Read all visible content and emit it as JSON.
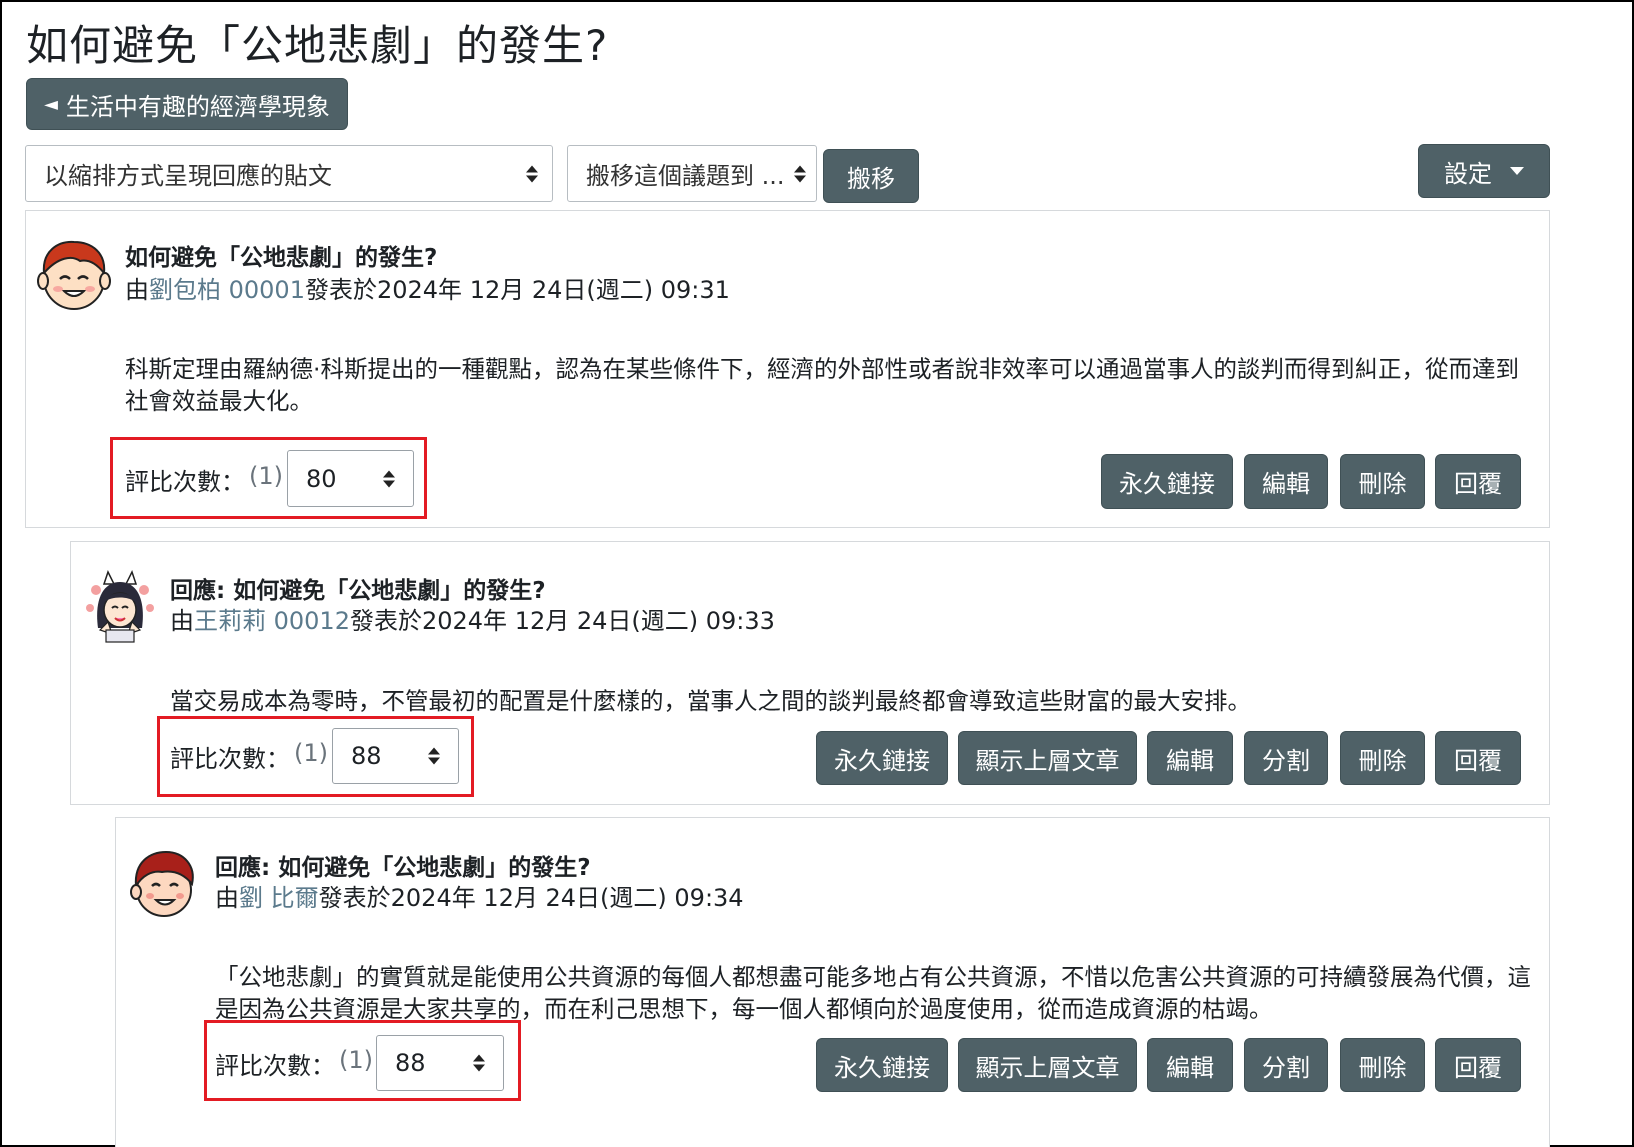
{
  "page": {
    "title": "如何避免「公地悲劇」的發生?"
  },
  "toolbar": {
    "back_button": "生活中有趣的經濟學現象",
    "display_mode_select": "以縮排方式呈現回應的貼文",
    "move_select": "搬移這個議題到 ...",
    "move_button": "搬移",
    "settings_button": "設定"
  },
  "posts": [
    {
      "title": "如何避免「公地悲劇」的發生?",
      "meta_prefix": "由",
      "author": "劉包柏 00001",
      "meta_suffix": "發表於2024年 12月 24日(週二) 09:31",
      "body": "科斯定理由羅納德·科斯提出的一種觀點，認為在某些條件下，經濟的外部性或者說非效率可以通過當事人的談判而得到糾正，從而達到社會效益最大化。",
      "rating_label": "評比次數：",
      "rating_count": "(1)",
      "rating_value": "80",
      "actions": [
        "永久鏈接",
        "編輯",
        "刪除",
        "回覆"
      ]
    },
    {
      "title": "回應: 如何避免「公地悲劇」的發生?",
      "meta_prefix": "由",
      "author": "王莉莉 00012",
      "meta_suffix": "發表於2024年 12月 24日(週二) 09:33",
      "body": "當交易成本為零時，不管最初的配置是什麼樣的，當事人之間的談判最終都會導致這些財富的最大安排。",
      "rating_label": "評比次數：",
      "rating_count": "(1)",
      "rating_value": "88",
      "actions": [
        "永久鏈接",
        "顯示上層文章",
        "編輯",
        "分割",
        "刪除",
        "回覆"
      ]
    },
    {
      "title": "回應: 如何避免「公地悲劇」的發生?",
      "meta_prefix": "由",
      "author": "劉 比爾",
      "meta_suffix": "發表於2024年 12月 24日(週二) 09:34",
      "body": "「公地悲劇」的實質就是能使用公共資源的每個人都想盡可能多地占有公共資源，不惜以危害公共資源的可持續發展為代價，這是因為公共資源是大家共享的，而在利己思想下，每一個人都傾向於過度使用，從而造成資源的枯竭。",
      "rating_label": "評比次數：",
      "rating_count": "(1)",
      "rating_value": "88",
      "actions": [
        "永久鏈接",
        "顯示上層文章",
        "編輯",
        "分割",
        "刪除",
        "回覆"
      ]
    }
  ],
  "colors": {
    "button": "#4f6167",
    "author_link": "#5b7a8c",
    "highlight": "#e31b23",
    "border": "#d6d9dc"
  },
  "icons": [
    "back-arrow-icon",
    "select-arrows-icon",
    "caret-down-icon",
    "avatar-boy-icon",
    "avatar-girl-icon",
    "avatar-man-icon"
  ]
}
